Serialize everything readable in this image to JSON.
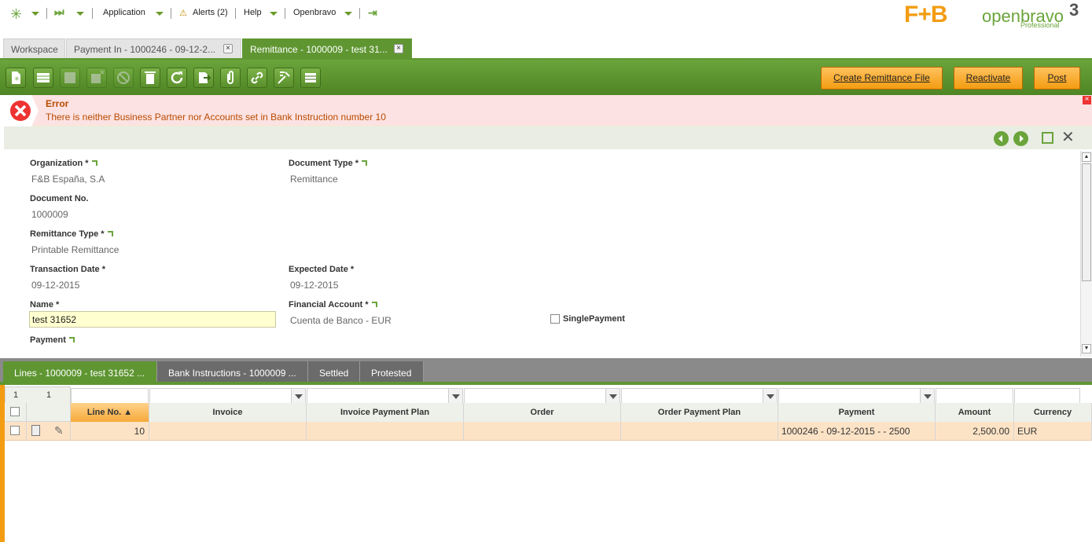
{
  "nav": {
    "application": "Application",
    "alerts": "Alerts (2)",
    "help": "Help",
    "openbravo": "Openbravo"
  },
  "brand": {
    "fb_logo": "F+B",
    "openbravo": "openbravo",
    "professional": "Professional",
    "version": "3"
  },
  "tabs": [
    {
      "label": "Workspace"
    },
    {
      "label": "Payment In - 1000246 - 09-12-2..."
    },
    {
      "label": "Remittance - 1000009 - test 31..."
    }
  ],
  "toolbar": {
    "create_remittance_file": "Create Remittance File",
    "reactivate": "Reactivate",
    "post": "Post"
  },
  "error": {
    "title": "Error",
    "message": "There is neither Business Partner nor Accounts set in Bank Instruction number 10"
  },
  "form": {
    "organization_label": "Organization *",
    "organization_value": "F&B España, S.A",
    "document_type_label": "Document Type *",
    "document_type_value": "Remittance",
    "document_no_label": "Document No.",
    "document_no_value": "1000009",
    "remittance_type_label": "Remittance Type *",
    "remittance_type_value": "Printable Remittance",
    "transaction_date_label": "Transaction Date *",
    "transaction_date_value": "09-12-2015",
    "expected_date_label": "Expected Date *",
    "expected_date_value": "09-12-2015",
    "name_label": "Name *",
    "name_value": "test 31652",
    "financial_account_label": "Financial Account *",
    "financial_account_value": "Cuenta de Banco - EUR",
    "single_payment_label": "SinglePayment",
    "payment_label": "Payment"
  },
  "subtabs": [
    {
      "label": "Lines - 1000009 - test 31652 ..."
    },
    {
      "label": "Bank Instructions - 1000009 ..."
    },
    {
      "label": "Settled"
    },
    {
      "label": "Protested"
    }
  ],
  "grid": {
    "count_left": "1",
    "count_right": "1",
    "columns": [
      "Line No.",
      "Invoice",
      "Invoice Payment Plan",
      "Order",
      "Order Payment Plan",
      "Payment",
      "Amount",
      "Currency"
    ],
    "rows": [
      {
        "line_no": "10",
        "invoice": "",
        "invoice_payment_plan": "",
        "order": "",
        "order_payment_plan": "",
        "payment": "1000246 - 09-12-2015 -  - 2500",
        "amount": "2,500.00",
        "currency": "EUR"
      }
    ]
  },
  "colors": {
    "accent": "#5f9632",
    "button": "#f39c12",
    "error_bg": "#fce2e2",
    "row_highlight": "#fde3c6"
  }
}
